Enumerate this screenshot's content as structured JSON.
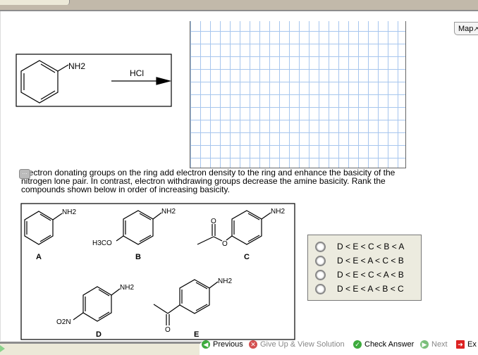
{
  "map_label": "Map",
  "reaction": {
    "reactant_label": "NH2",
    "reagent": "HCl"
  },
  "question": "Electron donating groups on the ring add electron density to the ring and enhance the basicity of the nitrogen lone pair. In contrast, electron withdrawing groups decrease the amine basicity. Rank the compounds shown below in order of increasing basicity.",
  "question_display": "ectron donating groups on the ring add electron density to the ring and enhance the basicity of the nitrogen lone pair. In contrast, electron withdrawing groups decrease the amine basicity. Rank the compounds shown below in order of increasing basicity.",
  "compounds": {
    "A": {
      "label": "A",
      "amine": "NH2"
    },
    "B": {
      "label": "B",
      "amine": "NH2",
      "sub": "H3CO"
    },
    "C": {
      "label": "C",
      "amine": "NH2",
      "o_ester": "O",
      "o_carbonyl": "O"
    },
    "D": {
      "label": "D",
      "amine": "NH2",
      "sub": "O2N"
    },
    "E": {
      "label": "E",
      "amine": "NH2",
      "o_carbonyl": "O"
    }
  },
  "options": [
    "D < E < C < B < A",
    "D < E < A < C < B",
    "D < E < C < A < B",
    "D < E < A < B < C"
  ],
  "footer": {
    "previous": "Previous",
    "give_up": "Give Up & View Solution",
    "check": "Check Answer",
    "next": "Next",
    "exit": "Ex"
  }
}
